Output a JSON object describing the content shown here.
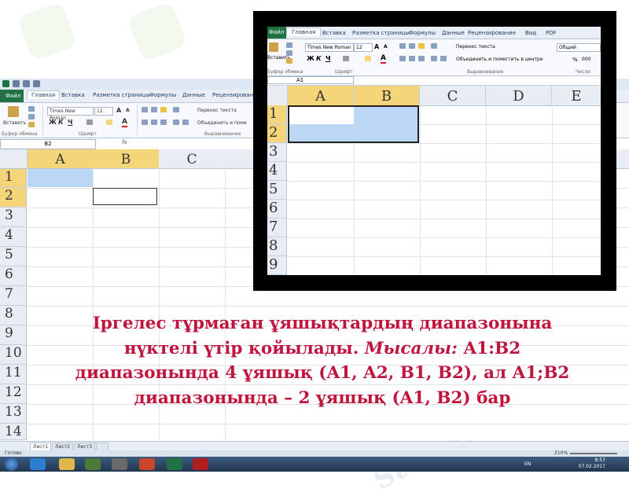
{
  "watermark": "Stud.kz",
  "excel": {
    "ribbon_tabs": [
      "Файл",
      "Главная",
      "Вставка",
      "Разметка страницы",
      "Формулы",
      "Данные",
      "Рецензирование"
    ],
    "ribbon": {
      "paste_label": "Вставить",
      "font_name": "Times New Roman",
      "font_size": "12",
      "wrap_text": "Перенос текста",
      "merge_center": "Объединить и поме",
      "groups": [
        "Буфер обмена",
        "Шрифт",
        "Выравнивание"
      ]
    },
    "name_box": "B2",
    "fx_label": "fx",
    "columns": [
      "A",
      "B",
      "C"
    ],
    "rows": [
      "1",
      "2",
      "3",
      "4",
      "5",
      "6",
      "7",
      "8",
      "9",
      "10",
      "11",
      "12",
      "13",
      "14"
    ],
    "sheet_tabs": [
      "Лист1",
      "Лист2",
      "Лист3"
    ],
    "status": "Готово",
    "zoom": "210%",
    "clock_time": "8:57",
    "clock_date": "07.02.2017",
    "lang": "EN"
  },
  "inset": {
    "ribbon_tabs": [
      "Файл",
      "Главная",
      "Вставка",
      "Разметка страницы",
      "Формулы",
      "Данные",
      "Рецензирование",
      "Вид",
      "PDF"
    ],
    "font_name": "Times New Roman",
    "font_size": "12",
    "wrap_text": "Перенос текста",
    "merge_center": "Объединить и поместить в центре",
    "number_format": "Общий",
    "paste_label": "Вставить",
    "groups": [
      "Буфер обмена",
      "Шрифт",
      "Выравнивание",
      "Число"
    ],
    "name_box": "A1",
    "columns": [
      "A",
      "B",
      "C",
      "D",
      "E"
    ],
    "rows": [
      "1",
      "2",
      "3",
      "4",
      "5",
      "6",
      "7",
      "8",
      "9"
    ]
  },
  "caption": {
    "line1": "Іргелес тұрмаған ұяшықтардың диапазонына",
    "line2_a": "нүктелі үтір қойылады. ",
    "line2_b": "Мысалы:",
    "line2_c": " A1:B2",
    "line3": "диапазонында 4 ұяшық (A1, A2, B1, B2), ал A1;B2",
    "line4": "диапазонында – 2 ұяшық (A1, B2) бар"
  }
}
